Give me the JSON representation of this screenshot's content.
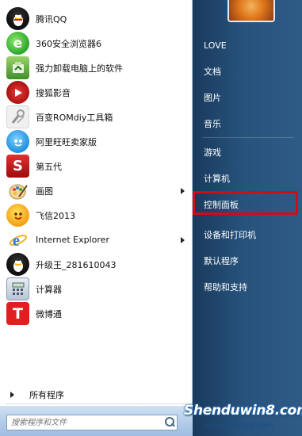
{
  "programs": [
    {
      "label": "腾讯QQ",
      "icon": "qq-penguin-icon",
      "submenu": false
    },
    {
      "label": "360安全浏览器6",
      "icon": "360-browser-icon",
      "submenu": false
    },
    {
      "label": "强力卸载电脑上的软件",
      "icon": "uninstaller-icon",
      "submenu": false
    },
    {
      "label": "搜狐影音",
      "icon": "sohu-video-icon",
      "submenu": false
    },
    {
      "label": "百变ROMdiy工具箱",
      "icon": "romdiy-toolbox-icon",
      "submenu": false
    },
    {
      "label": "阿里旺旺卖家版",
      "icon": "aliwangwang-icon",
      "submenu": false
    },
    {
      "label": "第五代",
      "icon": "fifth-gen-icon",
      "submenu": false
    },
    {
      "label": "画图",
      "icon": "paint-icon",
      "submenu": true
    },
    {
      "label": "飞信2013",
      "icon": "fetion-icon",
      "submenu": false
    },
    {
      "label": "Internet Explorer",
      "icon": "internet-explorer-icon",
      "submenu": true
    },
    {
      "label": "升级王_281610043",
      "icon": "upgrade-king-icon",
      "submenu": false
    },
    {
      "label": "计算器",
      "icon": "calculator-icon",
      "submenu": false
    },
    {
      "label": "微博通",
      "icon": "weibotong-icon",
      "submenu": false
    }
  ],
  "all_programs_label": "所有程序",
  "search": {
    "placeholder": "搜索程序和文件"
  },
  "right_items": [
    {
      "label": "LOVE"
    },
    {
      "label": "文档"
    },
    {
      "label": "图片"
    },
    {
      "label": "音乐"
    },
    {
      "label": "游戏"
    },
    {
      "label": "计算机"
    },
    {
      "label": "控制面板"
    },
    {
      "label": "设备和打印机"
    },
    {
      "label": "默认程序"
    },
    {
      "label": "帮助和支持"
    }
  ],
  "highlight_color": "#d20d10",
  "watermark": {
    "main": "Shenduwin8.com",
    "sub": "xitongcheng.com"
  }
}
